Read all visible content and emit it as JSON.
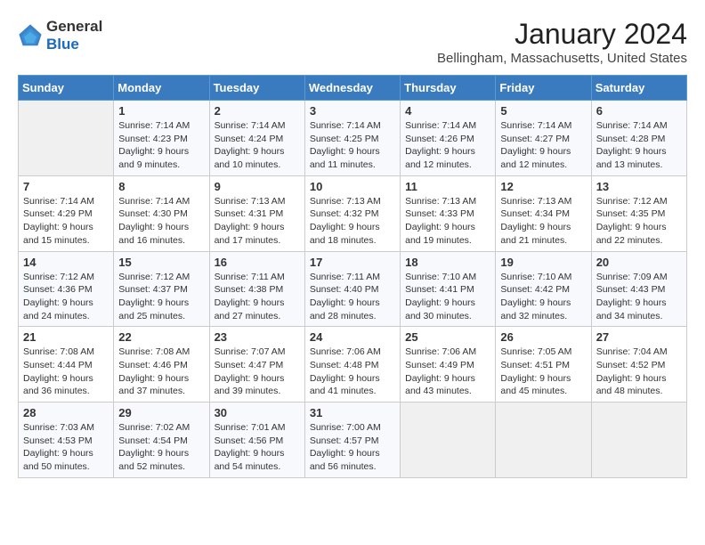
{
  "logo": {
    "text_general": "General",
    "text_blue": "Blue"
  },
  "title": "January 2024",
  "location": "Bellingham, Massachusetts, United States",
  "weekdays": [
    "Sunday",
    "Monday",
    "Tuesday",
    "Wednesday",
    "Thursday",
    "Friday",
    "Saturday"
  ],
  "weeks": [
    [
      {
        "day": "",
        "sunrise": "",
        "sunset": "",
        "daylight": ""
      },
      {
        "day": "1",
        "sunrise": "Sunrise: 7:14 AM",
        "sunset": "Sunset: 4:23 PM",
        "daylight": "Daylight: 9 hours and 9 minutes."
      },
      {
        "day": "2",
        "sunrise": "Sunrise: 7:14 AM",
        "sunset": "Sunset: 4:24 PM",
        "daylight": "Daylight: 9 hours and 10 minutes."
      },
      {
        "day": "3",
        "sunrise": "Sunrise: 7:14 AM",
        "sunset": "Sunset: 4:25 PM",
        "daylight": "Daylight: 9 hours and 11 minutes."
      },
      {
        "day": "4",
        "sunrise": "Sunrise: 7:14 AM",
        "sunset": "Sunset: 4:26 PM",
        "daylight": "Daylight: 9 hours and 12 minutes."
      },
      {
        "day": "5",
        "sunrise": "Sunrise: 7:14 AM",
        "sunset": "Sunset: 4:27 PM",
        "daylight": "Daylight: 9 hours and 12 minutes."
      },
      {
        "day": "6",
        "sunrise": "Sunrise: 7:14 AM",
        "sunset": "Sunset: 4:28 PM",
        "daylight": "Daylight: 9 hours and 13 minutes."
      }
    ],
    [
      {
        "day": "7",
        "sunrise": "Sunrise: 7:14 AM",
        "sunset": "Sunset: 4:29 PM",
        "daylight": "Daylight: 9 hours and 15 minutes."
      },
      {
        "day": "8",
        "sunrise": "Sunrise: 7:14 AM",
        "sunset": "Sunset: 4:30 PM",
        "daylight": "Daylight: 9 hours and 16 minutes."
      },
      {
        "day": "9",
        "sunrise": "Sunrise: 7:13 AM",
        "sunset": "Sunset: 4:31 PM",
        "daylight": "Daylight: 9 hours and 17 minutes."
      },
      {
        "day": "10",
        "sunrise": "Sunrise: 7:13 AM",
        "sunset": "Sunset: 4:32 PM",
        "daylight": "Daylight: 9 hours and 18 minutes."
      },
      {
        "day": "11",
        "sunrise": "Sunrise: 7:13 AM",
        "sunset": "Sunset: 4:33 PM",
        "daylight": "Daylight: 9 hours and 19 minutes."
      },
      {
        "day": "12",
        "sunrise": "Sunrise: 7:13 AM",
        "sunset": "Sunset: 4:34 PM",
        "daylight": "Daylight: 9 hours and 21 minutes."
      },
      {
        "day": "13",
        "sunrise": "Sunrise: 7:12 AM",
        "sunset": "Sunset: 4:35 PM",
        "daylight": "Daylight: 9 hours and 22 minutes."
      }
    ],
    [
      {
        "day": "14",
        "sunrise": "Sunrise: 7:12 AM",
        "sunset": "Sunset: 4:36 PM",
        "daylight": "Daylight: 9 hours and 24 minutes."
      },
      {
        "day": "15",
        "sunrise": "Sunrise: 7:12 AM",
        "sunset": "Sunset: 4:37 PM",
        "daylight": "Daylight: 9 hours and 25 minutes."
      },
      {
        "day": "16",
        "sunrise": "Sunrise: 7:11 AM",
        "sunset": "Sunset: 4:38 PM",
        "daylight": "Daylight: 9 hours and 27 minutes."
      },
      {
        "day": "17",
        "sunrise": "Sunrise: 7:11 AM",
        "sunset": "Sunset: 4:40 PM",
        "daylight": "Daylight: 9 hours and 28 minutes."
      },
      {
        "day": "18",
        "sunrise": "Sunrise: 7:10 AM",
        "sunset": "Sunset: 4:41 PM",
        "daylight": "Daylight: 9 hours and 30 minutes."
      },
      {
        "day": "19",
        "sunrise": "Sunrise: 7:10 AM",
        "sunset": "Sunset: 4:42 PM",
        "daylight": "Daylight: 9 hours and 32 minutes."
      },
      {
        "day": "20",
        "sunrise": "Sunrise: 7:09 AM",
        "sunset": "Sunset: 4:43 PM",
        "daylight": "Daylight: 9 hours and 34 minutes."
      }
    ],
    [
      {
        "day": "21",
        "sunrise": "Sunrise: 7:08 AM",
        "sunset": "Sunset: 4:44 PM",
        "daylight": "Daylight: 9 hours and 36 minutes."
      },
      {
        "day": "22",
        "sunrise": "Sunrise: 7:08 AM",
        "sunset": "Sunset: 4:46 PM",
        "daylight": "Daylight: 9 hours and 37 minutes."
      },
      {
        "day": "23",
        "sunrise": "Sunrise: 7:07 AM",
        "sunset": "Sunset: 4:47 PM",
        "daylight": "Daylight: 9 hours and 39 minutes."
      },
      {
        "day": "24",
        "sunrise": "Sunrise: 7:06 AM",
        "sunset": "Sunset: 4:48 PM",
        "daylight": "Daylight: 9 hours and 41 minutes."
      },
      {
        "day": "25",
        "sunrise": "Sunrise: 7:06 AM",
        "sunset": "Sunset: 4:49 PM",
        "daylight": "Daylight: 9 hours and 43 minutes."
      },
      {
        "day": "26",
        "sunrise": "Sunrise: 7:05 AM",
        "sunset": "Sunset: 4:51 PM",
        "daylight": "Daylight: 9 hours and 45 minutes."
      },
      {
        "day": "27",
        "sunrise": "Sunrise: 7:04 AM",
        "sunset": "Sunset: 4:52 PM",
        "daylight": "Daylight: 9 hours and 48 minutes."
      }
    ],
    [
      {
        "day": "28",
        "sunrise": "Sunrise: 7:03 AM",
        "sunset": "Sunset: 4:53 PM",
        "daylight": "Daylight: 9 hours and 50 minutes."
      },
      {
        "day": "29",
        "sunrise": "Sunrise: 7:02 AM",
        "sunset": "Sunset: 4:54 PM",
        "daylight": "Daylight: 9 hours and 52 minutes."
      },
      {
        "day": "30",
        "sunrise": "Sunrise: 7:01 AM",
        "sunset": "Sunset: 4:56 PM",
        "daylight": "Daylight: 9 hours and 54 minutes."
      },
      {
        "day": "31",
        "sunrise": "Sunrise: 7:00 AM",
        "sunset": "Sunset: 4:57 PM",
        "daylight": "Daylight: 9 hours and 56 minutes."
      },
      {
        "day": "",
        "sunrise": "",
        "sunset": "",
        "daylight": ""
      },
      {
        "day": "",
        "sunrise": "",
        "sunset": "",
        "daylight": ""
      },
      {
        "day": "",
        "sunrise": "",
        "sunset": "",
        "daylight": ""
      }
    ]
  ]
}
